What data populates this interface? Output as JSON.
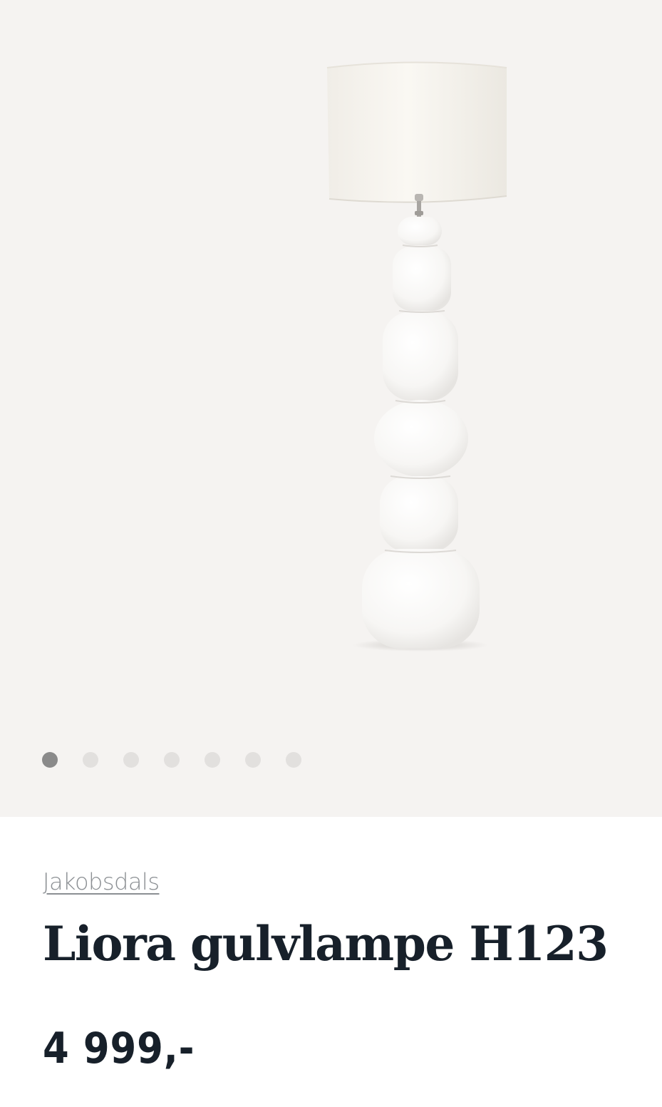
{
  "gallery": {
    "image_alt": "Liora gulvlampe H123",
    "dot_count": 7,
    "active_index": 0,
    "colors": {
      "background": "#f5f3f1",
      "dot_active": "#8a8a8a",
      "dot_inactive": "#e2e0de"
    }
  },
  "product": {
    "brand": "Jakobsdals",
    "title": "Liora gulvlampe H123",
    "price": "4 999,-"
  },
  "colors": {
    "text": "#17202a",
    "brand_link": "#8b8f93"
  }
}
